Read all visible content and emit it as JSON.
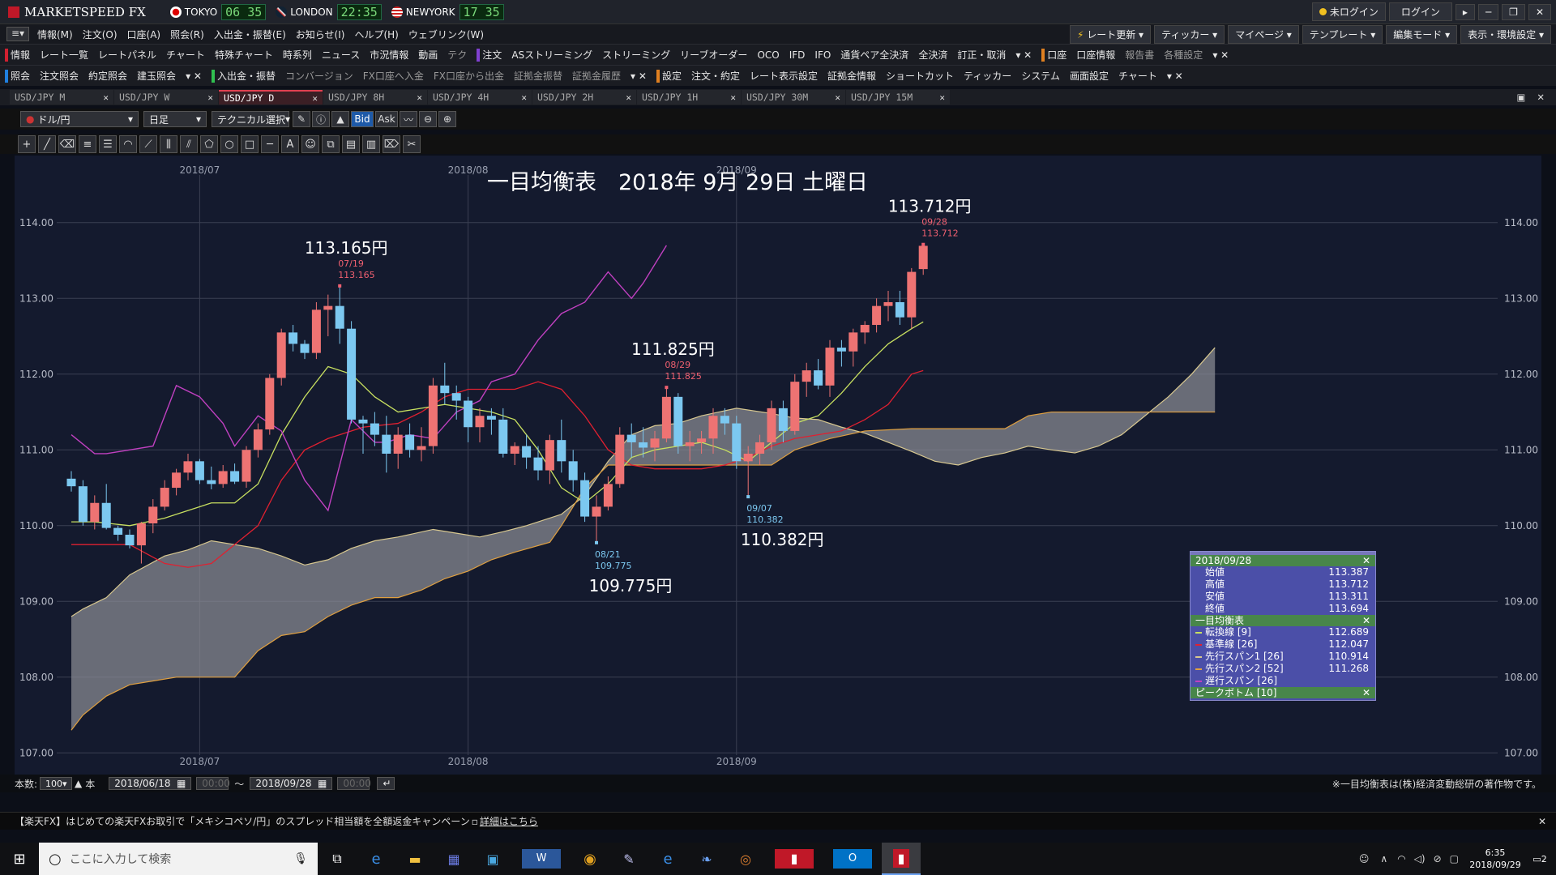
{
  "app": {
    "title": "MARKETSPEED FX"
  },
  "clocks": [
    {
      "city": "TOKYO",
      "time": "06 35"
    },
    {
      "city": "LONDON",
      "time": "22:35"
    },
    {
      "city": "NEWYORK",
      "time": "17 35"
    }
  ],
  "title_right": {
    "login_status": "未ログイン",
    "login_button": "ログイン"
  },
  "menu": [
    "情報(M)",
    "注文(O)",
    "口座(A)",
    "照会(R)",
    "入出金・振替(E)",
    "お知らせ(I)",
    "ヘルプ(H)",
    "ウェブリンク(W)"
  ],
  "menu_right": [
    "レート更新",
    "ティッカー",
    "マイページ",
    "テンプレート",
    "編集モード",
    "表示・環境設定"
  ],
  "toolbar1": {
    "info_section": "情報",
    "info_items": [
      "レート一覧",
      "レートパネル",
      "チャート",
      "特殊チャート",
      "時系列",
      "ニュース",
      "市況情報",
      "動画",
      "テク"
    ],
    "order_section": "注文",
    "order_items": [
      "ASストリーミング",
      "ストリーミング",
      "リーブオーダー",
      "OCO",
      "IFD",
      "IFO",
      "通貨ペア全決済",
      "全決済",
      "訂正・取消"
    ],
    "account_section": "口座",
    "account_items": [
      "口座情報",
      "報告書",
      "各種設定"
    ]
  },
  "toolbar2": {
    "inquiry_section": "照会",
    "inquiry_items": [
      "注文照会",
      "約定照会",
      "建玉照会"
    ],
    "transfer_section": "入出金・振替",
    "transfer_items": [
      "コンバージョン",
      "FX口座へ入金",
      "FX口座から出金",
      "証拠金振替",
      "証拠金履歴"
    ],
    "settings_section": "設定",
    "settings_items": [
      "注文・約定",
      "レート表示設定",
      "証拠金情報",
      "ショートカット",
      "ティッカー",
      "システム",
      "画面設定",
      "チャート"
    ]
  },
  "tabs": [
    {
      "label": "USD/JPY M"
    },
    {
      "label": "USD/JPY W"
    },
    {
      "label": "USD/JPY D",
      "active": true
    },
    {
      "label": "USD/JPY 8H"
    },
    {
      "label": "USD/JPY 4H"
    },
    {
      "label": "USD/JPY 2H"
    },
    {
      "label": "USD/JPY 1H"
    },
    {
      "label": "USD/JPY 30M"
    },
    {
      "label": "USD/JPY 15M"
    }
  ],
  "chart_toolbar": {
    "pair": "ドル/円",
    "interval": "日足",
    "technical": "テクニカル選択",
    "bid": "Bid",
    "ask": "Ask"
  },
  "chart_data": {
    "type": "candlestick",
    "instrument": "USD/JPY",
    "title": "一目均衡表　2018年 9月 29日 土曜日",
    "ylim": [
      106.8,
      114.8
    ],
    "y_ticks": [
      "114.00",
      "113.00",
      "112.00",
      "111.00",
      "110.00",
      "109.00",
      "108.00",
      "107.00"
    ],
    "month_labels": [
      {
        "label": "2018/07",
        "i": 11
      },
      {
        "label": "2018/08",
        "i": 34
      },
      {
        "label": "2018/09",
        "i": 57
      }
    ],
    "candles": [
      [
        110.62,
        110.72,
        110.45,
        110.52
      ],
      [
        110.52,
        110.6,
        110.0,
        110.05
      ],
      [
        110.05,
        110.4,
        109.95,
        110.3
      ],
      [
        110.3,
        110.55,
        109.95,
        109.97
      ],
      [
        109.97,
        110.0,
        109.8,
        109.88
      ],
      [
        109.88,
        109.95,
        109.7,
        109.74
      ],
      [
        109.74,
        110.05,
        109.5,
        110.03
      ],
      [
        110.03,
        110.35,
        109.9,
        110.25
      ],
      [
        110.25,
        110.6,
        110.2,
        110.5
      ],
      [
        110.5,
        110.75,
        110.4,
        110.7
      ],
      [
        110.7,
        110.95,
        110.6,
        110.85
      ],
      [
        110.85,
        110.88,
        110.55,
        110.6
      ],
      [
        110.6,
        110.78,
        110.48,
        110.55
      ],
      [
        110.55,
        110.8,
        110.5,
        110.72
      ],
      [
        110.72,
        110.82,
        110.55,
        110.58
      ],
      [
        110.58,
        111.05,
        110.5,
        111.0
      ],
      [
        111.0,
        111.35,
        110.9,
        111.27
      ],
      [
        111.27,
        112.0,
        111.2,
        111.95
      ],
      [
        111.95,
        112.6,
        111.85,
        112.55
      ],
      [
        112.55,
        112.65,
        112.3,
        112.4
      ],
      [
        112.4,
        112.45,
        112.2,
        112.28
      ],
      [
        112.28,
        112.95,
        112.2,
        112.85
      ],
      [
        112.85,
        113.05,
        112.5,
        112.9
      ],
      [
        112.9,
        113.165,
        112.4,
        112.6
      ],
      [
        112.6,
        112.7,
        111.35,
        111.4
      ],
      [
        111.4,
        111.45,
        110.95,
        111.35
      ],
      [
        111.35,
        111.5,
        111.05,
        111.2
      ],
      [
        111.2,
        111.45,
        110.7,
        110.95
      ],
      [
        110.95,
        111.3,
        110.75,
        111.2
      ],
      [
        111.2,
        111.35,
        110.9,
        111.0
      ],
      [
        111.0,
        111.3,
        110.85,
        111.05
      ],
      [
        111.05,
        111.95,
        110.95,
        111.85
      ],
      [
        111.85,
        112.15,
        111.6,
        111.75
      ],
      [
        111.75,
        111.85,
        111.4,
        111.65
      ],
      [
        111.65,
        111.7,
        111.1,
        111.3
      ],
      [
        111.3,
        111.55,
        111.1,
        111.45
      ],
      [
        111.45,
        111.55,
        111.2,
        111.4
      ],
      [
        111.4,
        111.55,
        110.9,
        110.95
      ],
      [
        110.95,
        111.1,
        110.8,
        111.05
      ],
      [
        111.05,
        111.2,
        110.75,
        110.9
      ],
      [
        110.9,
        111.05,
        110.6,
        110.73
      ],
      [
        110.73,
        111.2,
        110.55,
        111.13
      ],
      [
        111.13,
        111.4,
        110.7,
        110.85
      ],
      [
        110.85,
        111.0,
        110.45,
        110.6
      ],
      [
        110.6,
        110.7,
        110.05,
        110.12
      ],
      [
        110.12,
        110.4,
        109.775,
        110.25
      ],
      [
        110.25,
        110.65,
        110.2,
        110.55
      ],
      [
        110.55,
        111.3,
        110.5,
        111.2
      ],
      [
        111.2,
        111.35,
        110.9,
        111.1
      ],
      [
        111.1,
        111.3,
        110.9,
        111.03
      ],
      [
        111.03,
        111.25,
        110.85,
        111.15
      ],
      [
        111.15,
        111.825,
        111.1,
        111.7
      ],
      [
        111.7,
        111.75,
        110.95,
        111.05
      ],
      [
        111.05,
        111.25,
        110.85,
        111.1
      ],
      [
        111.1,
        111.25,
        110.95,
        111.15
      ],
      [
        111.15,
        111.55,
        110.95,
        111.45
      ],
      [
        111.45,
        111.55,
        111.2,
        111.35
      ],
      [
        111.35,
        111.45,
        110.75,
        110.85
      ],
      [
        110.85,
        111.05,
        110.382,
        110.95
      ],
      [
        110.95,
        111.2,
        110.8,
        111.1
      ],
      [
        111.1,
        111.65,
        111.0,
        111.55
      ],
      [
        111.55,
        111.65,
        111.1,
        111.25
      ],
      [
        111.25,
        112.0,
        111.2,
        111.9
      ],
      [
        111.9,
        112.15,
        111.7,
        112.05
      ],
      [
        112.05,
        112.2,
        111.8,
        111.85
      ],
      [
        111.85,
        112.45,
        111.7,
        112.35
      ],
      [
        112.35,
        112.45,
        112.1,
        112.3
      ],
      [
        112.3,
        112.6,
        112.1,
        112.55
      ],
      [
        112.55,
        112.7,
        112.4,
        112.65
      ],
      [
        112.65,
        113.0,
        112.55,
        112.9
      ],
      [
        112.9,
        113.1,
        112.7,
        112.95
      ],
      [
        112.95,
        113.1,
        112.65,
        112.75
      ],
      [
        112.75,
        113.4,
        112.6,
        113.35
      ],
      [
        113.387,
        113.712,
        113.311,
        113.694
      ]
    ],
    "kumo_a": [
      [
        0,
        108.8
      ],
      [
        1,
        108.9
      ],
      [
        3,
        109.05
      ],
      [
        5,
        109.35
      ],
      [
        8,
        109.6
      ],
      [
        10,
        109.68
      ],
      [
        12,
        109.8
      ],
      [
        14,
        109.75
      ],
      [
        16,
        109.7
      ],
      [
        18,
        109.6
      ],
      [
        20,
        109.48
      ],
      [
        22,
        109.55
      ],
      [
        24,
        109.7
      ],
      [
        26,
        109.8
      ],
      [
        28,
        109.85
      ],
      [
        31,
        109.95
      ],
      [
        33,
        109.9
      ],
      [
        35,
        109.85
      ],
      [
        37,
        109.92
      ],
      [
        39,
        110.0
      ],
      [
        42,
        110.15
      ],
      [
        44,
        110.4
      ],
      [
        46,
        110.85
      ],
      [
        48,
        111.2
      ],
      [
        50,
        111.32
      ],
      [
        52,
        111.35
      ],
      [
        54,
        111.45
      ],
      [
        57,
        111.55
      ],
      [
        60,
        111.48
      ],
      [
        62,
        111.42
      ],
      [
        64,
        111.4
      ],
      [
        66,
        111.3
      ],
      [
        68,
        111.22
      ],
      [
        70,
        111.1
      ],
      [
        72,
        110.98
      ],
      [
        74,
        110.85
      ],
      [
        76,
        110.8
      ],
      [
        78,
        110.9
      ],
      [
        80,
        110.96
      ],
      [
        82,
        111.05
      ],
      [
        84,
        111.0
      ],
      [
        86,
        110.96
      ],
      [
        88,
        111.05
      ],
      [
        90,
        111.2
      ],
      [
        92,
        111.45
      ],
      [
        94,
        111.7
      ],
      [
        96,
        112.0
      ],
      [
        98,
        112.35
      ]
    ],
    "kumo_b": [
      [
        0,
        107.3
      ],
      [
        1,
        107.5
      ],
      [
        3,
        107.75
      ],
      [
        5,
        107.9
      ],
      [
        7,
        107.95
      ],
      [
        9,
        108.0
      ],
      [
        12,
        108.0
      ],
      [
        14,
        108.0
      ],
      [
        16,
        108.35
      ],
      [
        18,
        108.55
      ],
      [
        20,
        108.6
      ],
      [
        22,
        108.8
      ],
      [
        24,
        108.95
      ],
      [
        26,
        109.05
      ],
      [
        28,
        109.05
      ],
      [
        30,
        109.15
      ],
      [
        32,
        109.3
      ],
      [
        34,
        109.4
      ],
      [
        36,
        109.55
      ],
      [
        38,
        109.65
      ],
      [
        41,
        109.78
      ],
      [
        42,
        110.0
      ],
      [
        44,
        110.5
      ],
      [
        46,
        110.8
      ],
      [
        48,
        110.8
      ],
      [
        50,
        110.8
      ],
      [
        52,
        110.8
      ],
      [
        54,
        110.8
      ],
      [
        57,
        110.8
      ],
      [
        60,
        110.8
      ],
      [
        62,
        111.0
      ],
      [
        65,
        111.15
      ],
      [
        68,
        111.25
      ],
      [
        72,
        111.28
      ],
      [
        76,
        111.28
      ],
      [
        80,
        111.28
      ],
      [
        82,
        111.45
      ],
      [
        84,
        111.5
      ],
      [
        86,
        111.5
      ],
      [
        88,
        111.5
      ],
      [
        90,
        111.5
      ],
      [
        92,
        111.5
      ],
      [
        94,
        111.5
      ],
      [
        96,
        111.5
      ],
      [
        98,
        111.5
      ]
    ],
    "tenkan": [
      [
        0,
        110.05
      ],
      [
        2,
        110.05
      ],
      [
        5,
        110.0
      ],
      [
        8,
        110.1
      ],
      [
        10,
        110.2
      ],
      [
        12,
        110.3
      ],
      [
        14,
        110.3
      ],
      [
        16,
        110.55
      ],
      [
        18,
        111.2
      ],
      [
        20,
        111.7
      ],
      [
        22,
        112.1
      ],
      [
        24,
        112.0
      ],
      [
        26,
        111.7
      ],
      [
        28,
        111.5
      ],
      [
        30,
        111.55
      ],
      [
        32,
        111.6
      ],
      [
        34,
        111.55
      ],
      [
        36,
        111.5
      ],
      [
        38,
        111.4
      ],
      [
        40,
        111.0
      ],
      [
        42,
        110.5
      ],
      [
        44,
        110.3
      ],
      [
        46,
        110.55
      ],
      [
        48,
        110.9
      ],
      [
        50,
        111.0
      ],
      [
        52,
        111.05
      ],
      [
        54,
        111.1
      ],
      [
        56,
        111.0
      ],
      [
        58,
        110.85
      ],
      [
        60,
        111.1
      ],
      [
        62,
        111.35
      ],
      [
        64,
        111.45
      ],
      [
        66,
        111.75
      ],
      [
        68,
        112.1
      ],
      [
        70,
        112.4
      ],
      [
        72,
        112.6
      ],
      [
        73,
        112.69
      ]
    ],
    "kijun": [
      [
        0,
        109.75
      ],
      [
        5,
        109.75
      ],
      [
        8,
        109.5
      ],
      [
        10,
        109.45
      ],
      [
        12,
        109.5
      ],
      [
        14,
        109.75
      ],
      [
        16,
        110.0
      ],
      [
        18,
        110.6
      ],
      [
        20,
        111.0
      ],
      [
        22,
        111.15
      ],
      [
        25,
        111.3
      ],
      [
        28,
        111.35
      ],
      [
        30,
        111.5
      ],
      [
        32,
        111.7
      ],
      [
        34,
        111.8
      ],
      [
        36,
        111.8
      ],
      [
        38,
        111.8
      ],
      [
        40,
        111.9
      ],
      [
        42,
        111.8
      ],
      [
        44,
        111.45
      ],
      [
        46,
        111.0
      ],
      [
        48,
        110.8
      ],
      [
        50,
        110.75
      ],
      [
        52,
        110.75
      ],
      [
        54,
        110.75
      ],
      [
        56,
        110.8
      ],
      [
        58,
        110.9
      ],
      [
        60,
        111.05
      ],
      [
        62,
        111.15
      ],
      [
        64,
        111.2
      ],
      [
        66,
        111.25
      ],
      [
        68,
        111.4
      ],
      [
        70,
        111.6
      ],
      [
        72,
        112.0
      ],
      [
        73,
        112.047
      ]
    ],
    "chikou": [
      [
        0,
        111.2
      ],
      [
        2,
        110.95
      ],
      [
        3,
        110.95
      ],
      [
        5,
        111.0
      ],
      [
        7,
        111.05
      ],
      [
        9,
        111.85
      ],
      [
        11,
        111.7
      ],
      [
        13,
        111.35
      ],
      [
        14,
        111.05
      ],
      [
        16,
        111.45
      ],
      [
        18,
        111.25
      ],
      [
        20,
        110.6
      ],
      [
        21,
        110.4
      ],
      [
        22,
        110.2
      ],
      [
        24,
        111.4
      ],
      [
        26,
        111.1
      ],
      [
        27,
        111.1
      ],
      [
        29,
        111.2
      ],
      [
        31,
        111.15
      ],
      [
        33,
        111.5
      ],
      [
        35,
        111.65
      ],
      [
        36,
        111.9
      ],
      [
        38,
        112.0
      ],
      [
        40,
        112.45
      ],
      [
        42,
        112.8
      ],
      [
        44,
        112.95
      ],
      [
        46,
        113.35
      ],
      [
        48,
        113.0
      ],
      [
        49,
        113.2
      ],
      [
        51,
        113.7
      ]
    ],
    "annotations": [
      {
        "i": 23,
        "price": 113.165,
        "big": "113.165円",
        "date": "07/19",
        "value": "113.165",
        "pos": "above"
      },
      {
        "i": 45,
        "price": 109.775,
        "big": "109.775円",
        "date": "08/21",
        "value": "109.775",
        "pos": "below"
      },
      {
        "i": 51,
        "price": 111.825,
        "big": "111.825円",
        "date": "08/29",
        "value": "111.825",
        "pos": "above"
      },
      {
        "i": 58,
        "price": 110.382,
        "big": "110.382円",
        "date": "09/07",
        "value": "110.382",
        "pos": "below"
      },
      {
        "i": 73,
        "price": 113.712,
        "big": "113.712円",
        "date": "09/28",
        "value": "113.712",
        "pos": "above"
      }
    ],
    "colors": {
      "up": "#ee7373",
      "down": "#7cc8f0",
      "tenkan": "#c8e060",
      "kijun": "#e02030",
      "chikou": "#c040c0",
      "kumo": "#8a8c94",
      "span_a": "#d8c890",
      "span_b": "#e0a040",
      "grid": "#3a3f52"
    }
  },
  "info_panel": {
    "date": "2018/09/28",
    "ohlc": [
      {
        "label": "始値",
        "value": "113.387"
      },
      {
        "label": "高値",
        "value": "113.712"
      },
      {
        "label": "安値",
        "value": "113.311"
      },
      {
        "label": "終値",
        "value": "113.694"
      }
    ],
    "ichimoku_header": "一目均衡表",
    "ichimoku": [
      {
        "label": "転換線 [9]",
        "value": "112.689",
        "color": "#c8e060"
      },
      {
        "label": "基準線 [26]",
        "value": "112.047",
        "color": "#e02030"
      },
      {
        "label": "先行スパン1 [26]",
        "value": "110.914",
        "color": "#d8c890"
      },
      {
        "label": "先行スパン2 [52]",
        "value": "111.268",
        "color": "#e0a040"
      },
      {
        "label": "遅行スパン [26]",
        "value": "",
        "color": "#c040c0"
      }
    ],
    "peak_header": "ピークボトム [10]"
  },
  "footer": {
    "count_label": "本数:",
    "count": "100",
    "unit": "本",
    "from": "2018/06/18",
    "time_placeholder": "00:00",
    "tilde": "～",
    "to": "2018/09/28",
    "copyright": "※一目均衡表は(株)経済変動総研の著作物です。"
  },
  "banner": {
    "text": "【楽天FX】はじめての楽天FXお取引で「メキシコペソ/円」のスプレッド相当額を全額返金キャンペーン",
    "link": "詳細はこちら"
  },
  "taskbar": {
    "search_placeholder": "ここに入力して検索",
    "time": "6:35",
    "date": "2018/09/29",
    "notifications": "2"
  }
}
